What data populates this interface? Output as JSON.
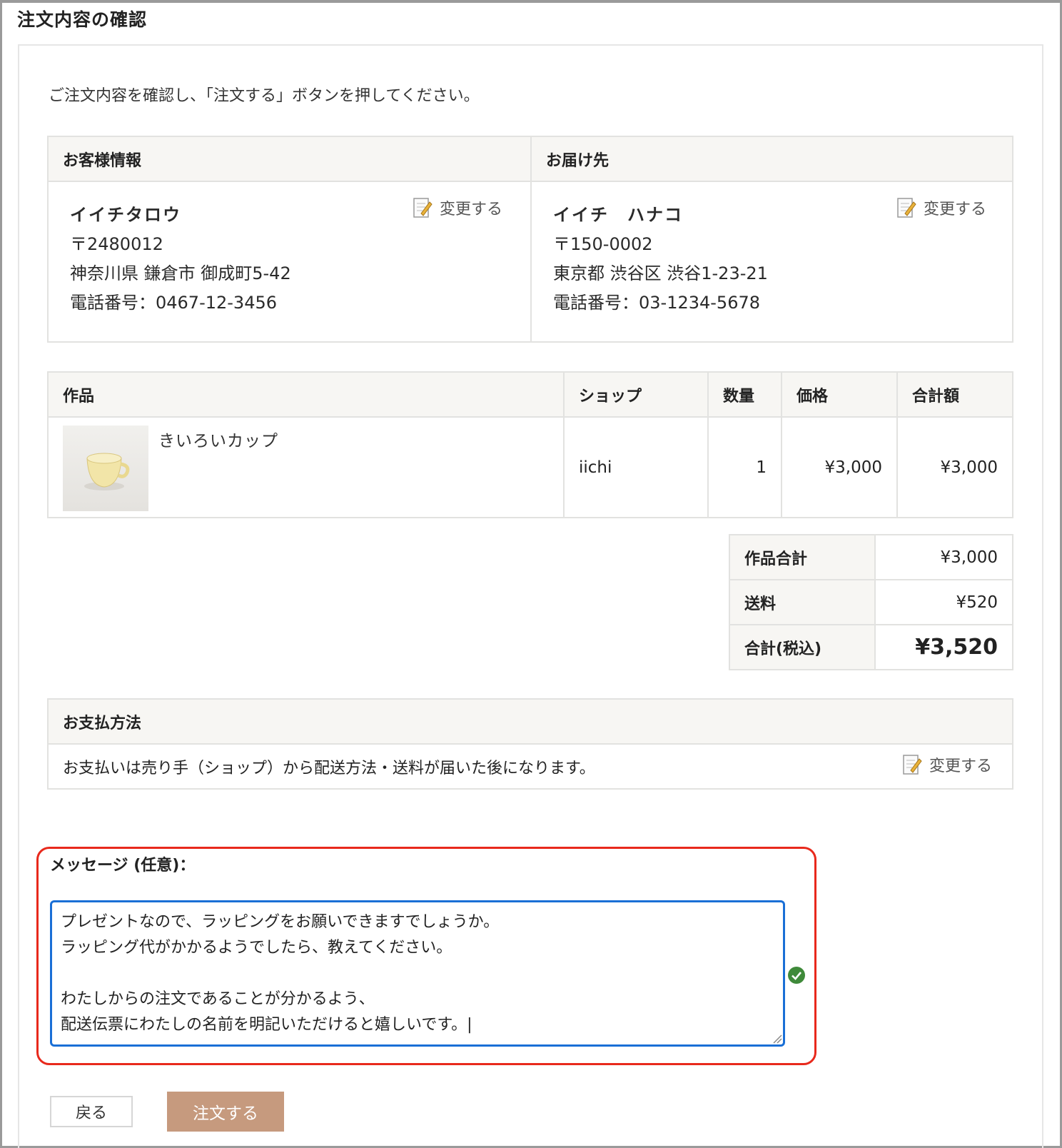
{
  "page": {
    "title": "注文内容の確認",
    "intro": "ご注文内容を確認し、「注文する」ボタンを押してください。"
  },
  "customer": {
    "header": "お客様情報",
    "name": "イイチタロウ",
    "postal": "〒2480012",
    "address": "神奈川県 鎌倉市 御成町5-42",
    "phone": "電話番号：0467-12-3456",
    "change_label": "変更する"
  },
  "shipping": {
    "header": "お届け先",
    "name": "イイチ　ハナコ",
    "postal": "〒150-0002",
    "address": "東京都 渋谷区 渋谷1-23-21",
    "phone": "電話番号：03-1234-5678",
    "change_label": "変更する"
  },
  "items": {
    "headers": {
      "product": "作品",
      "shop": "ショップ",
      "qty": "数量",
      "price": "価格",
      "subtotal": "合計額"
    },
    "rows": [
      {
        "name": "きいろいカップ",
        "shop": "iichi",
        "qty": "1",
        "price": "¥3,000",
        "subtotal": "¥3,000",
        "image": "yellow-cup-thumbnail"
      }
    ]
  },
  "totals": {
    "items_label": "作品合計",
    "items_value": "¥3,000",
    "shipping_label": "送料",
    "shipping_value": "¥520",
    "grand_label": "合計(税込)",
    "grand_value": "¥3,520"
  },
  "payment": {
    "header": "お支払方法",
    "text": "お支払いは売り手（ショップ）から配送方法・送料が届いた後になります。",
    "change_label": "変更する"
  },
  "message": {
    "label": "メッセージ (任意)：",
    "value": "プレゼントなので、ラッピングをお願いできますでしょうか。\nラッピング代がかかるようでしたら、教えてください。\n\nわたしからの注文であることが分かるよう、\n配送伝票にわたしの名前を明記いただけると嬉しいです。|"
  },
  "buttons": {
    "back": "戻る",
    "order": "注文する"
  },
  "colors": {
    "highlight": "#e8291c",
    "focus": "#1a6fd6",
    "order_button": "#c69a7e",
    "header_bg": "#f7f6f3"
  }
}
